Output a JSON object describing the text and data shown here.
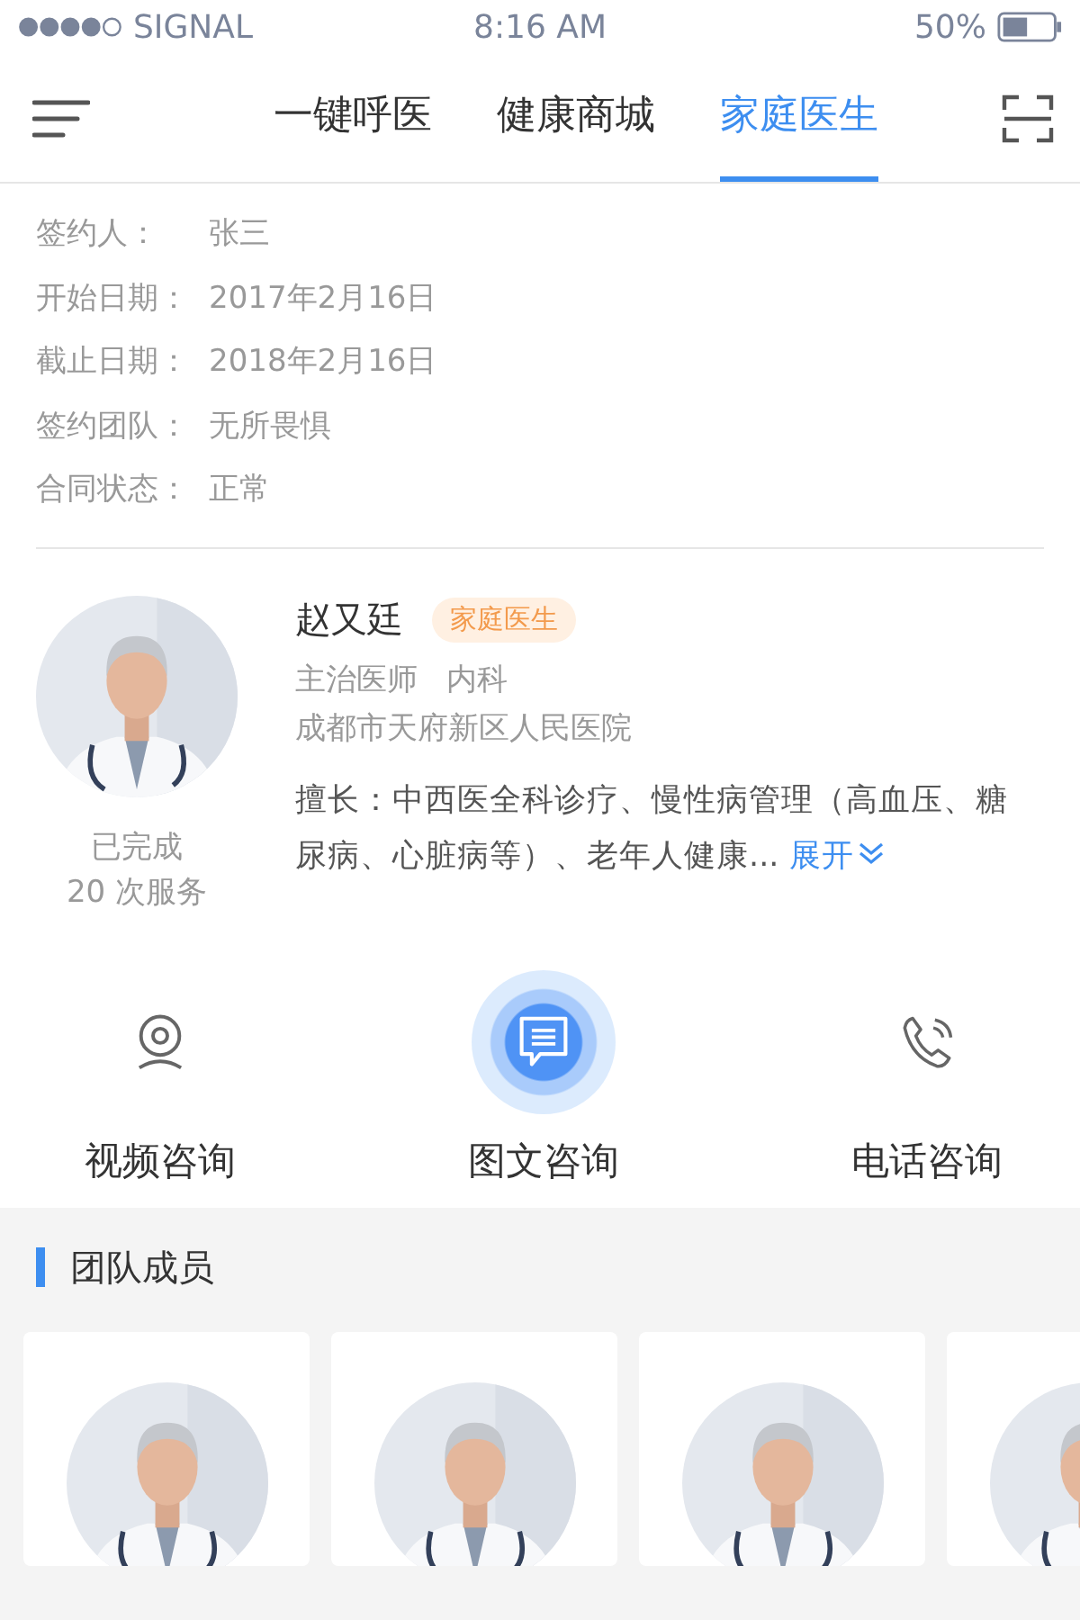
{
  "status_bar": {
    "signal_text": "SIGNAL",
    "time": "8:16 AM",
    "battery": "50%"
  },
  "tabs": [
    {
      "label": "一键呼医",
      "selected": false
    },
    {
      "label": "健康商城",
      "selected": false
    },
    {
      "label": "家庭医生",
      "selected": true
    }
  ],
  "contract": [
    {
      "label": "签约人：",
      "value": "张三"
    },
    {
      "label": "开始日期：",
      "value": "2017年2月16日"
    },
    {
      "label": "截止日期：",
      "value": "2018年2月16日"
    },
    {
      "label": "签约团队：",
      "value": "无所畏惧"
    },
    {
      "label": "合同状态：",
      "value": "正常"
    }
  ],
  "doctor": {
    "name": "赵又廷",
    "badge": "家庭医生",
    "title": "主治医师",
    "department": "内科",
    "hospital": "成都市天府新区人民医院",
    "stat_line_1": "已完成",
    "stat_line_2": "20 次服务",
    "specialty": "擅长：中西医全科诊疗、慢性病管理（高血压、糖尿病、心脏病等）、老年人健康...",
    "expand_link": "展开"
  },
  "consult_options": [
    {
      "kind": "video",
      "label": "视频咨询",
      "selected": false
    },
    {
      "kind": "chat",
      "label": "图文咨询",
      "selected": true
    },
    {
      "kind": "phone",
      "label": "电话咨询",
      "selected": false
    }
  ],
  "team": {
    "title": "团队成员"
  }
}
